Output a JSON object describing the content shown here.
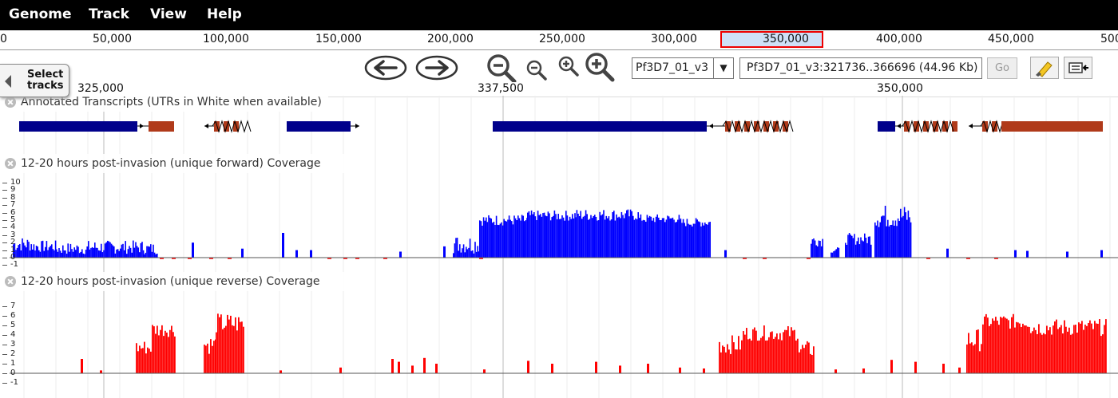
{
  "menu": {
    "genome": "Genome",
    "track": "Track",
    "view": "View",
    "help": "Help"
  },
  "overview": {
    "ticks": [
      "0",
      "50,000",
      "100,000",
      "150,000",
      "200,000",
      "250,000",
      "300,000",
      "350,000",
      "400,000",
      "450,000",
      "500"
    ]
  },
  "nav": {
    "refseq": "Pf3D7_01_v3",
    "location": "Pf3D7_01_v3:321736..366696 (44.96 Kb)",
    "go_label": "Go"
  },
  "select_tracks": {
    "line1": "Select",
    "line2": "tracks"
  },
  "detail_scale": {
    "ticks": [
      "325,000",
      "337,500",
      "350,000"
    ]
  },
  "tracks": {
    "annot": {
      "label": "Annotated Transcripts (UTRs in White when available)"
    },
    "forward": {
      "label": "12-20 hours post-invasion (unique forward) Coverage",
      "color": "#0000ff",
      "yticks": [
        "10",
        "9",
        "8",
        "7",
        "6",
        "5",
        "4",
        "3",
        "2",
        "1",
        "0",
        "-1"
      ]
    },
    "reverse": {
      "label": "12-20 hours post-invasion (unique reverse) Coverage",
      "color": "#ff0000",
      "yticks": [
        "7",
        "6",
        "5",
        "4",
        "3",
        "2",
        "1",
        "0",
        "-1"
      ]
    }
  },
  "colors": {
    "cds": "#00008b",
    "utr": "#b03a1a",
    "forward": "#0000ff",
    "reverse": "#ff0000"
  }
}
